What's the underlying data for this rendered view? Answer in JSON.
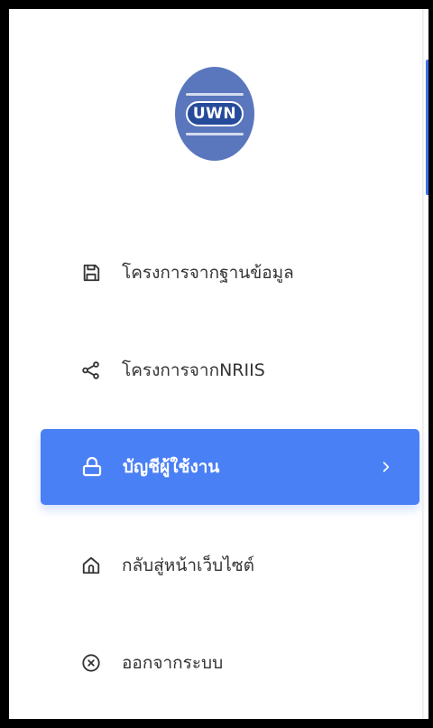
{
  "logo": {
    "text": "UWN",
    "brand_color": "#5a76bd"
  },
  "menu": {
    "items": [
      {
        "label": "โครงการจากฐานข้อมูล",
        "icon": "save-icon"
      },
      {
        "label": "โครงการจากNRIIS",
        "icon": "share-icon"
      },
      {
        "label": "บัญชีผู้ใช้งาน",
        "icon": "lock-icon",
        "active": true
      },
      {
        "label": "กลับสู่หน้าเว็บไซต์",
        "icon": "home-icon"
      },
      {
        "label": "ออกจากระบบ",
        "icon": "close-circle-icon"
      }
    ],
    "active_color": "#4a80f6"
  }
}
